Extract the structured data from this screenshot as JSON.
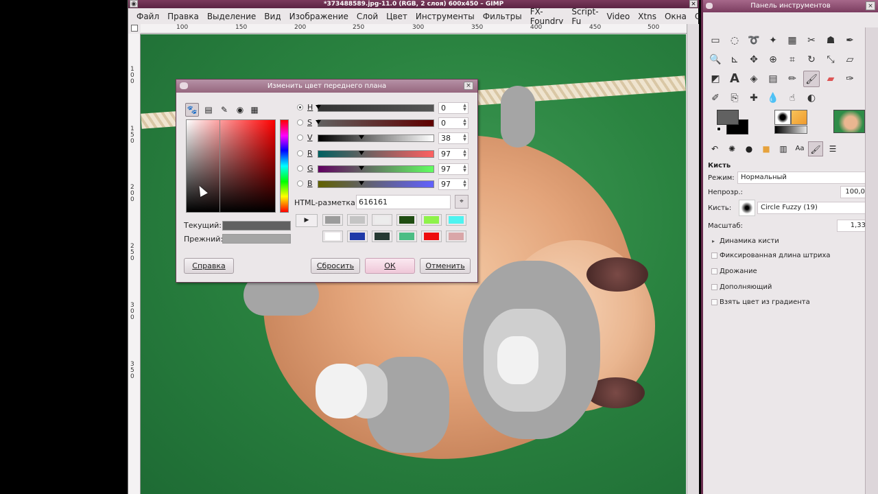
{
  "main_window": {
    "title": "*373488589.jpg-11.0 (RGB, 2 слоя) 600x450 – GIMP",
    "menu": [
      "Файл",
      "Правка",
      "Выделение",
      "Вид",
      "Изображение",
      "Слой",
      "Цвет",
      "Инструменты",
      "Фильтры",
      "FX-Foundry",
      "Script-Fu",
      "Video",
      "Xtns",
      "Окна",
      "Справка"
    ],
    "ruler_top": [
      "100",
      "150",
      "200",
      "250",
      "300",
      "350",
      "400",
      "450",
      "500"
    ],
    "ruler_left": [
      "100",
      "150",
      "200",
      "250",
      "300",
      "350"
    ]
  },
  "dialog": {
    "title": "Изменить цвет переднего плана",
    "channels": [
      {
        "key": "H",
        "value": "0",
        "marker": 0.0
      },
      {
        "key": "S",
        "value": "0",
        "marker": 0.0
      },
      {
        "key": "V",
        "value": "38",
        "marker": 0.38
      },
      {
        "key": "R",
        "value": "97",
        "marker": 0.38
      },
      {
        "key": "G",
        "value": "97",
        "marker": 0.38
      },
      {
        "key": "B",
        "value": "97",
        "marker": 0.38
      }
    ],
    "html_label": "HTML-разметка:",
    "html_value": "616161",
    "current_label": "Текущий:",
    "previous_label": "Прежний:",
    "current_color": "#616161",
    "previous_color": "#a5a5a5",
    "history_colors": [
      "#9b9b9b",
      "#c4c4c4",
      "#ececec",
      "#1f4d12",
      "#8ef24a",
      "#4ef3f0",
      "#ffffff",
      "#1f3aa8",
      "#263a33",
      "#4bbd84",
      "#ee0d0d",
      "#d9a6a8"
    ],
    "btn_help": "Справка",
    "btn_reset": "Сбросить",
    "btn_ok": "ОК",
    "btn_cancel": "Отменить"
  },
  "toolbox": {
    "title": "Панель инструментов",
    "options_title": "Кисть",
    "mode_label": "Режим:",
    "mode_value": "Нормальный",
    "opacity_label": "Непрозр.:",
    "opacity_value": "100,0",
    "brush_label": "Кисть:",
    "brush_value": "Circle Fuzzy (19)",
    "scale_label": "Масштаб:",
    "scale_value": "1,33",
    "dynamics_label": "Динамика кисти",
    "opt_fixed": "Фиксированная длина штриха",
    "opt_jitter": "Дрожание",
    "opt_incremental": "Дополняющий",
    "opt_gradient": "Взять цвет из градиента"
  }
}
